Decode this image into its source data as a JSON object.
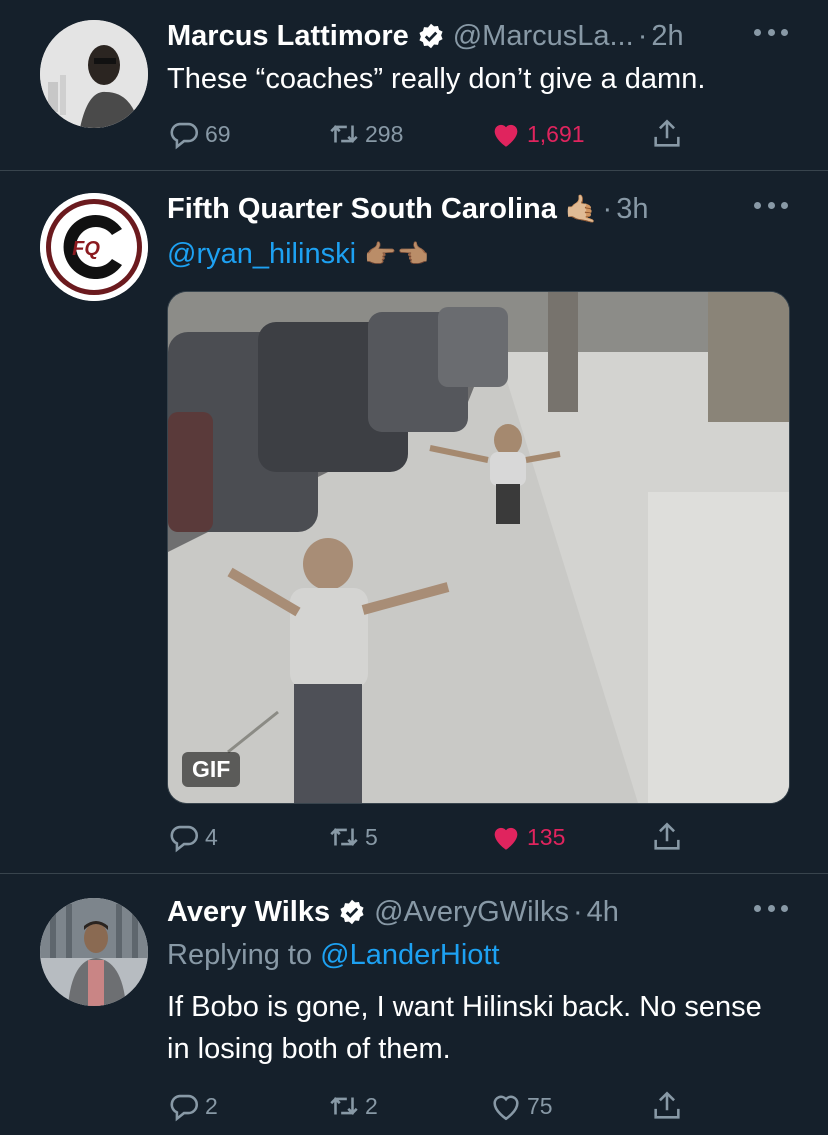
{
  "tweets": [
    {
      "name": "Marcus Lattimore",
      "handle": "@MarcusLa...",
      "time": "2h",
      "text": "These “coaches” really don’t give a damn.",
      "stats": {
        "replies": "69",
        "retweets": "298",
        "likes": "1,691"
      }
    },
    {
      "name": "Fifth Quarter South Carolina",
      "emoji": "🤙🏼",
      "time": "3h",
      "mention": "@ryan_hilinski",
      "emoji_after": "👉🏽👈🏽",
      "avatar_text": "FQ",
      "media": {
        "badge": "GIF"
      },
      "stats": {
        "replies": "4",
        "retweets": "5",
        "likes": "135"
      }
    },
    {
      "name": "Avery Wilks",
      "handle": "@AveryGWilks",
      "time": "4h",
      "replying_prefix": "Replying to",
      "replying_to": "@LanderHiott",
      "text": "If Bobo is gone, I want Hilinski back. No sense in losing both of them.",
      "stats": {
        "replies": "2",
        "retweets": "2",
        "likes": "75"
      }
    }
  ],
  "colors": {
    "background": "#15202b",
    "secondary_text": "#8899a6",
    "link": "#1da1f2",
    "like": "#e0245e",
    "divider": "#38444d"
  }
}
